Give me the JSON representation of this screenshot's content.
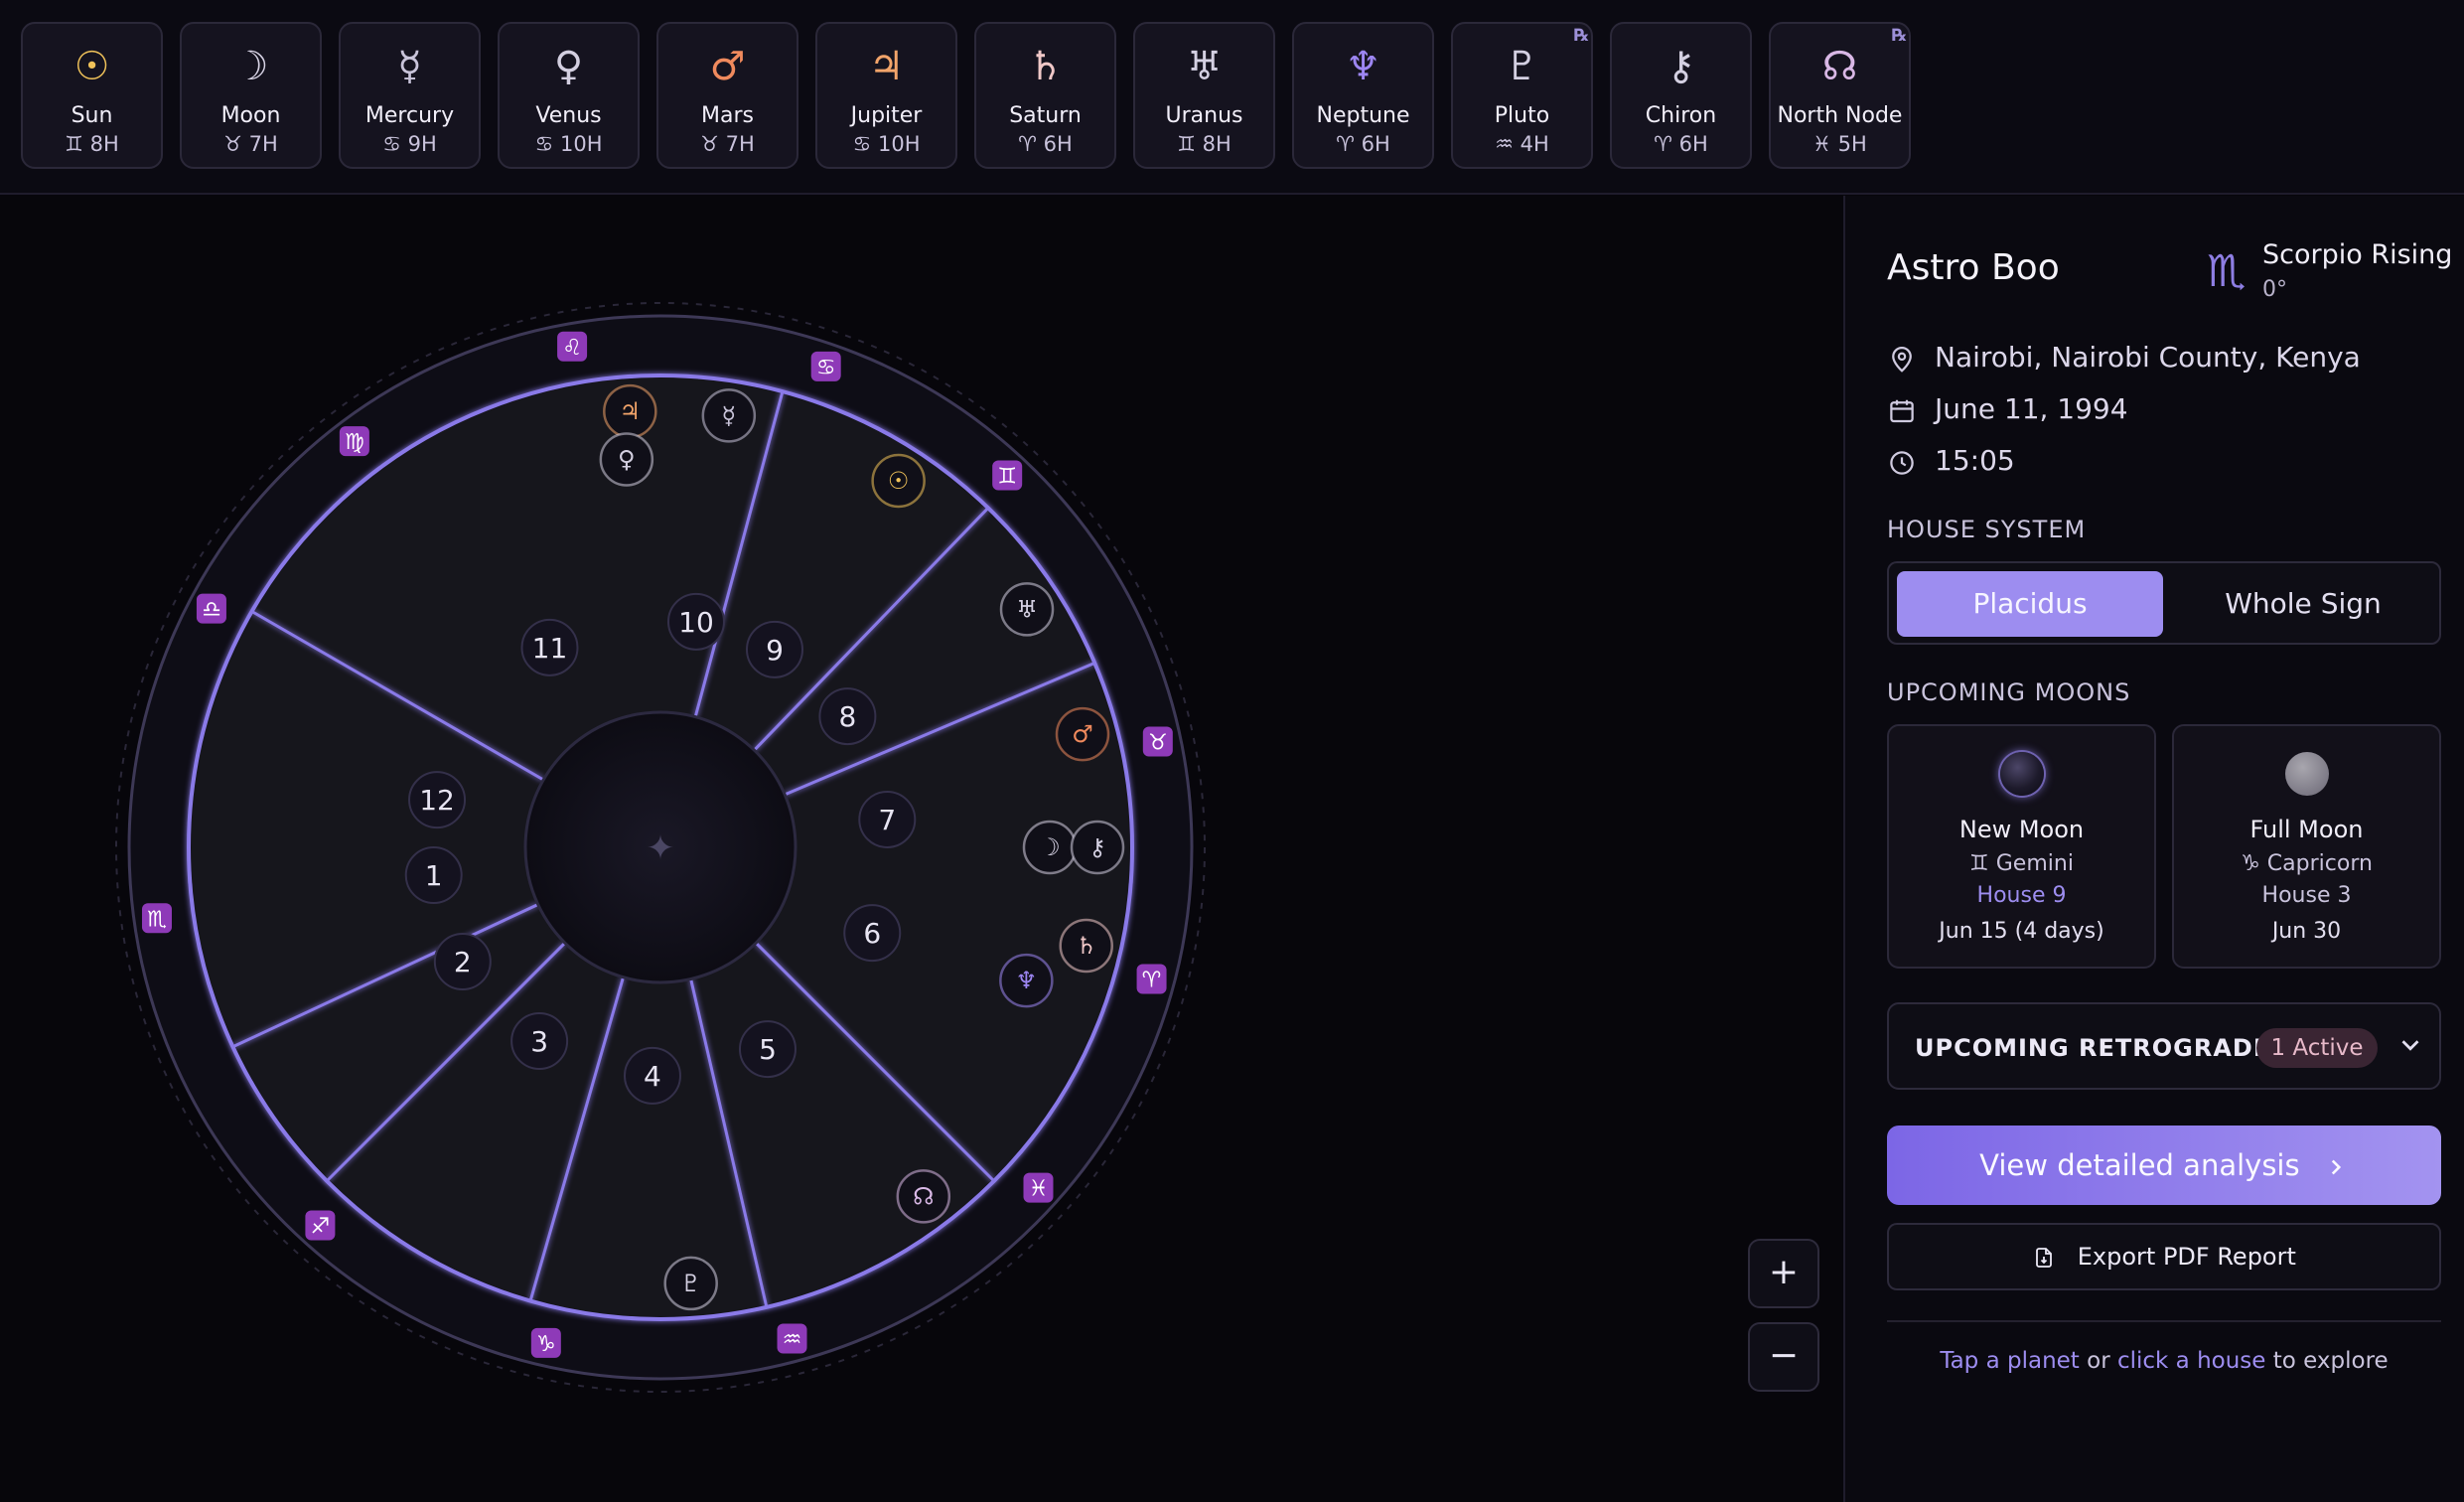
{
  "planets": [
    {
      "key": "sun",
      "name": "Sun",
      "glyph": "☉",
      "position": "♊︎ 8H",
      "color": "#f1c35a",
      "retro": false
    },
    {
      "key": "moon",
      "name": "Moon",
      "glyph": "☽",
      "position": "♉︎ 7H",
      "color": "#d8d4e6",
      "retro": false
    },
    {
      "key": "mercury",
      "name": "Mercury",
      "glyph": "☿",
      "position": "♋︎ 9H",
      "color": "#c9c4da",
      "retro": false
    },
    {
      "key": "venus",
      "name": "Venus",
      "glyph": "♀",
      "position": "♋︎ 10H",
      "color": "#d3cfe0",
      "retro": false
    },
    {
      "key": "mars",
      "name": "Mars",
      "glyph": "♂",
      "position": "♉︎ 7H",
      "color": "#f08a5d",
      "retro": false
    },
    {
      "key": "jupiter",
      "name": "Jupiter",
      "glyph": "♃",
      "position": "♋︎ 10H",
      "color": "#f2a46a",
      "retro": false
    },
    {
      "key": "saturn",
      "name": "Saturn",
      "glyph": "♄",
      "position": "♈︎ 6H",
      "color": "#f0c8c8",
      "retro": false
    },
    {
      "key": "uranus",
      "name": "Uranus",
      "glyph": "♅",
      "position": "♊︎ 8H",
      "color": "#d4d0e2",
      "retro": false
    },
    {
      "key": "neptune",
      "name": "Neptune",
      "glyph": "♆",
      "position": "♈︎ 6H",
      "color": "#9d86f2",
      "retro": false
    },
    {
      "key": "pluto",
      "name": "Pluto",
      "glyph": "♇",
      "position": "♒︎ 4H",
      "color": "#d4d0e2",
      "retro": true
    },
    {
      "key": "chiron",
      "name": "Chiron",
      "glyph": "⚷",
      "position": "♈︎ 6H",
      "color": "#d4d0e2",
      "retro": false
    },
    {
      "key": "north-node",
      "name": "North Node",
      "glyph": "☊",
      "position": "♓︎ 5H",
      "color": "#d9b8e6",
      "retro": true
    }
  ],
  "retro_mark": "℞",
  "wheel": {
    "houses": [
      {
        "n": "1",
        "mid": 187
      },
      {
        "n": "2",
        "mid": 210
      },
      {
        "n": "3",
        "mid": 238
      },
      {
        "n": "4",
        "mid": 268
      },
      {
        "n": "5",
        "mid": 298
      },
      {
        "n": "6",
        "mid": 338
      },
      {
        "n": "7",
        "mid": 7
      },
      {
        "n": "8",
        "mid": 35
      },
      {
        "n": "9",
        "mid": 60
      },
      {
        "n": "10",
        "mid": 81
      },
      {
        "n": "11",
        "mid": 119
      },
      {
        "n": "12",
        "mid": 168
      }
    ],
    "cusps": [
      180,
      205,
      225,
      254,
      283,
      315,
      0,
      23,
      46,
      75,
      90,
      150
    ],
    "signs": [
      {
        "glyph": "♌︎",
        "angle": 100
      },
      {
        "glyph": "♋︎",
        "angle": 71
      },
      {
        "glyph": "♊︎",
        "angle": 47
      },
      {
        "glyph": "♉︎",
        "angle": 12
      },
      {
        "glyph": "♈︎",
        "angle": 345
      },
      {
        "glyph": "♓︎",
        "angle": 318
      },
      {
        "glyph": "♒︎",
        "angle": 285
      },
      {
        "glyph": "♑︎",
        "angle": 257
      },
      {
        "glyph": "♐︎",
        "angle": 228
      },
      {
        "glyph": "♏︎",
        "angle": 188
      },
      {
        "glyph": "♎︎",
        "angle": 152
      },
      {
        "glyph": "♍︎",
        "angle": 127
      }
    ],
    "planet_markers": [
      {
        "glyph": "♃",
        "angle": 94,
        "ring": "outer",
        "color": "#f2a46a"
      },
      {
        "glyph": "☿",
        "angle": 81,
        "ring": "outer",
        "color": "#c9c4da"
      },
      {
        "glyph": "♀",
        "angle": 95,
        "ring": "inner",
        "color": "#d3cfe0"
      },
      {
        "glyph": "☉",
        "angle": 57,
        "ring": "outer",
        "color": "#f1c35a"
      },
      {
        "glyph": "♅",
        "angle": 33,
        "ring": "outer",
        "color": "#d4d0e2"
      },
      {
        "glyph": "♂",
        "angle": 15,
        "ring": "outer",
        "color": "#f08a5d"
      },
      {
        "glyph": "☽",
        "angle": 0,
        "ring": "inner",
        "color": "#d8d4e6"
      },
      {
        "glyph": "⚷",
        "angle": 0,
        "ring": "outer",
        "color": "#d4d0e2"
      },
      {
        "glyph": "♄",
        "angle": 347,
        "ring": "outer",
        "color": "#f0c8c8"
      },
      {
        "glyph": "♆",
        "angle": 340,
        "ring": "inner",
        "color": "#9d86f2"
      },
      {
        "glyph": "☊",
        "angle": 307,
        "ring": "outer",
        "color": "#d9b8e6"
      },
      {
        "glyph": "♇",
        "angle": 274,
        "ring": "outer",
        "color": "#d4d0e2"
      }
    ],
    "center_glyph": "✦"
  },
  "zoom": {
    "in": "+",
    "out": "−"
  },
  "panel": {
    "name": "Astro Boo",
    "rising_icon": "♏︎",
    "rising_label": "Scorpio Rising",
    "rising_degree": "0°",
    "location": "Nairobi, Nairobi County, Kenya",
    "date": "June 11, 1994",
    "time": "15:05",
    "house_system_title": "HOUSE SYSTEM",
    "house_systems": [
      "Placidus",
      "Whole Sign"
    ],
    "moons_title": "UPCOMING MOONS",
    "moons": [
      {
        "type": "New Moon",
        "sign": "♊︎ Gemini",
        "house": "House 9",
        "date": "Jun 15 (4 days)"
      },
      {
        "type": "Full Moon",
        "sign": "♑︎ Capricorn",
        "house": "House 3",
        "date": "Jun 30"
      }
    ],
    "retro_title": "UPCOMING RETROGRADES",
    "retro_badge": "1 Active",
    "analysis_button": "View detailed analysis",
    "export_button": "Export PDF Report",
    "hint": {
      "a": "Tap a planet",
      "b": " or ",
      "c": "click a house",
      "d": " to explore"
    }
  }
}
